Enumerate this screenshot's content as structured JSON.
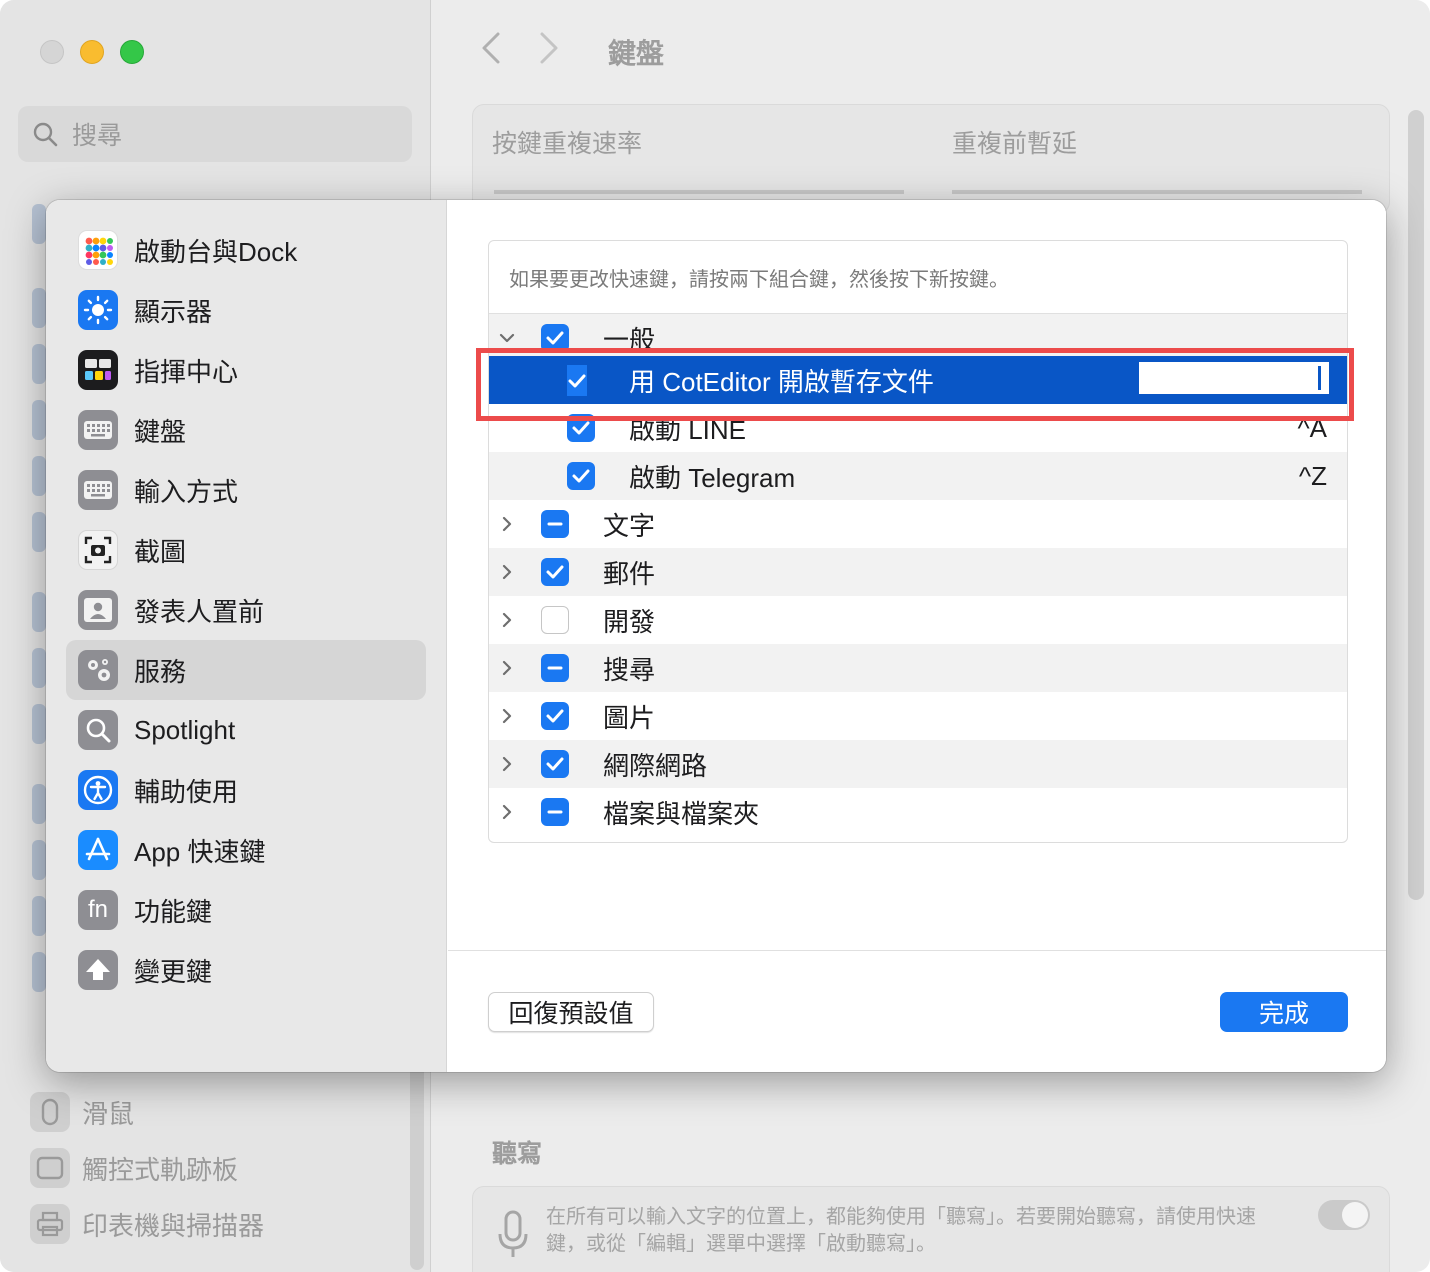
{
  "background": {
    "search_placeholder": "搜尋",
    "page_title": "鍵盤",
    "key_repeat_label": "按鍵重複速率",
    "delay_label": "重複前暫延",
    "dictation_heading": "聽寫",
    "dictation_text": "在所有可以輸入文字的位置上，都能夠使用「聽寫」。若要開始聽寫，請使用快速鍵，或從「編輯」選單中選擇「啟動聽寫」。",
    "sidebar_items": [
      {
        "label": "滑鼠",
        "icon": "mouse-icon"
      },
      {
        "label": "觸控式軌跡板",
        "icon": "trackpad-icon"
      },
      {
        "label": "印表機與掃描器",
        "icon": "printer-icon"
      }
    ]
  },
  "sheet": {
    "categories": [
      {
        "label": "啟動台與Dock",
        "icon": "launchpad-icon"
      },
      {
        "label": "顯示器",
        "icon": "display-icon"
      },
      {
        "label": "指揮中心",
        "icon": "mission-control-icon"
      },
      {
        "label": "鍵盤",
        "icon": "keyboard-icon"
      },
      {
        "label": "輸入方式",
        "icon": "input-sources-icon"
      },
      {
        "label": "截圖",
        "icon": "screenshot-icon"
      },
      {
        "label": "發表人置前",
        "icon": "presenter-overlay-icon"
      },
      {
        "label": "服務",
        "icon": "services-icon",
        "selected": true
      },
      {
        "label": "Spotlight",
        "icon": "spotlight-icon"
      },
      {
        "label": "輔助使用",
        "icon": "accessibility-icon"
      },
      {
        "label": "App 快速鍵",
        "icon": "app-shortcuts-icon"
      },
      {
        "label": "功能鍵",
        "icon": "function-keys-icon"
      },
      {
        "label": "變更鍵",
        "icon": "modifier-keys-icon"
      }
    ],
    "hint": "如果要更改快速鍵，請按兩下組合鍵，然後按下新按鍵。",
    "groups": [
      {
        "label": "一般",
        "state": "checked",
        "expanded": true
      },
      {
        "label": "文字",
        "state": "mixed"
      },
      {
        "label": "郵件",
        "state": "checked"
      },
      {
        "label": "開發",
        "state": "unchecked"
      },
      {
        "label": "搜尋",
        "state": "mixed"
      },
      {
        "label": "圖片",
        "state": "checked"
      },
      {
        "label": "網際網路",
        "state": "checked"
      },
      {
        "label": "檔案與檔案夾",
        "state": "mixed"
      }
    ],
    "general_items": [
      {
        "label": "用 CotEditor 開啟暫存文件",
        "shortcut": "",
        "state": "checked",
        "selected": true
      },
      {
        "label": "啟動 LINE",
        "shortcut": "^A",
        "state": "checked"
      },
      {
        "label": "啟動 Telegram",
        "shortcut": "^Z",
        "state": "checked"
      }
    ],
    "reset_label": "回復預設值",
    "done_label": "完成",
    "colors": {
      "accent": "#1a78f2",
      "selection": "#0956c6",
      "highlight_frame": "#ec4b4b"
    }
  }
}
